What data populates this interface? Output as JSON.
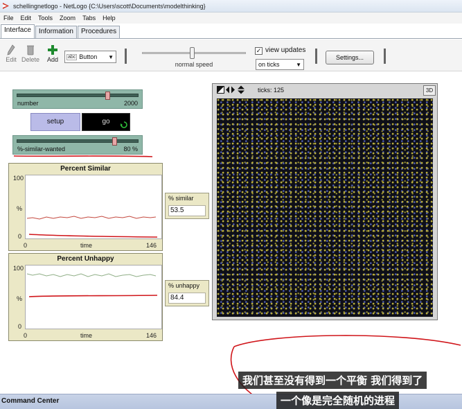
{
  "window": {
    "title": "schellingnetlogo - NetLogo {C:\\Users\\scott\\Documents\\modelthinking}"
  },
  "menu": [
    "File",
    "Edit",
    "Tools",
    "Zoom",
    "Tabs",
    "Help"
  ],
  "tabs": [
    "Interface",
    "Information",
    "Procedures"
  ],
  "toolbar": {
    "edit": "Edit",
    "delete": "Delete",
    "add": "Add",
    "widget_type": "Button",
    "widget_prefix": "abc",
    "speed_label": "normal speed",
    "speed_value": 0.5,
    "view_updates_label": "view updates",
    "view_updates_checked": true,
    "update_mode": "on ticks",
    "settings": "Settings..."
  },
  "sliders": {
    "number": {
      "label": "number",
      "value": "2000",
      "fraction": 0.89
    },
    "similar": {
      "label": "%-similar-wanted",
      "value": "80 %",
      "fraction": 0.8
    }
  },
  "buttons": {
    "setup": "setup",
    "go": "go"
  },
  "plots": {
    "similar": {
      "title": "Percent Similar",
      "ymax": "100",
      "ymin": "0",
      "ylabel": "%",
      "xmin": "0",
      "xmax": "146",
      "xlabel": "time"
    },
    "unhappy": {
      "title": "Percent Unhappy",
      "ymax": "100",
      "ymin": "0",
      "ylabel": "%",
      "xmin": "0",
      "xmax": "146",
      "xlabel": "time"
    }
  },
  "monitors": {
    "similar": {
      "label": "% similar",
      "value": "53.5"
    },
    "unhappy": {
      "label": "% unhappy",
      "value": "84.4"
    }
  },
  "view": {
    "ticks_label": "ticks: 125",
    "btn3d": "3D"
  },
  "command_center": "Command Center",
  "subtitles": {
    "line1": "我们甚至没有得到一个平衡 我们得到了",
    "line2": "一个像是完全随机的进程"
  }
}
